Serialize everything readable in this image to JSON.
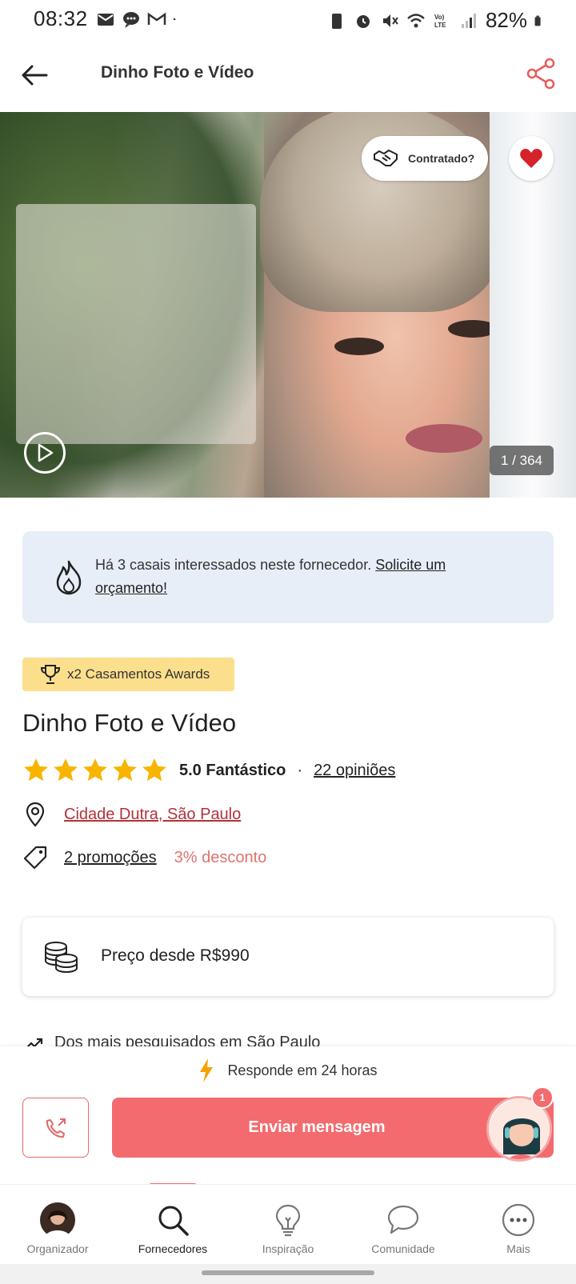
{
  "status_bar": {
    "time": "08:32",
    "battery": "82%",
    "network": "LTE"
  },
  "app_bar": {
    "title": "Dinho Foto e Vídeo",
    "back_icon": "arrow-left-icon",
    "share_icon": "share-icon"
  },
  "hero": {
    "contratado_label": "Contratado?",
    "counter": "1 / 364"
  },
  "interest": {
    "text": "Há 3 casais interessados neste fornecedor. ",
    "link": "Solicite um orçamento!"
  },
  "awards": {
    "label": "x2 Casamentos Awards"
  },
  "vendor": {
    "name": "Dinho Foto e Vídeo",
    "rating_stars": 5,
    "rating_text": "5.0 Fantástico",
    "separator": "·",
    "reviews": "22 opiniões",
    "location": "Cidade Dutra, São Paulo",
    "promotions": "2 promoções",
    "discount": "3% desconto"
  },
  "price": {
    "label": "Preço desde R$990"
  },
  "trending": {
    "label": "Dos mais pesquisados em São Paulo"
  },
  "actions": {
    "respond": "Responde em 24 horas",
    "send_label": "Enviar mensagem",
    "badge": "1"
  },
  "tabs": [
    {
      "label": "Organizador",
      "icon": "avatar"
    },
    {
      "label": "Fornecedores",
      "icon": "search-icon"
    },
    {
      "label": "Inspiração",
      "icon": "lightbulb-icon"
    },
    {
      "label": "Comunidade",
      "icon": "chat-bubble-icon"
    },
    {
      "label": "Mais",
      "icon": "more-icon"
    }
  ],
  "colors": {
    "accent": "#f36b6e",
    "link_red": "#b2323a",
    "star": "#f7b500",
    "awards_bg": "#fbdf8c",
    "interest_bg": "#e8eef8"
  }
}
